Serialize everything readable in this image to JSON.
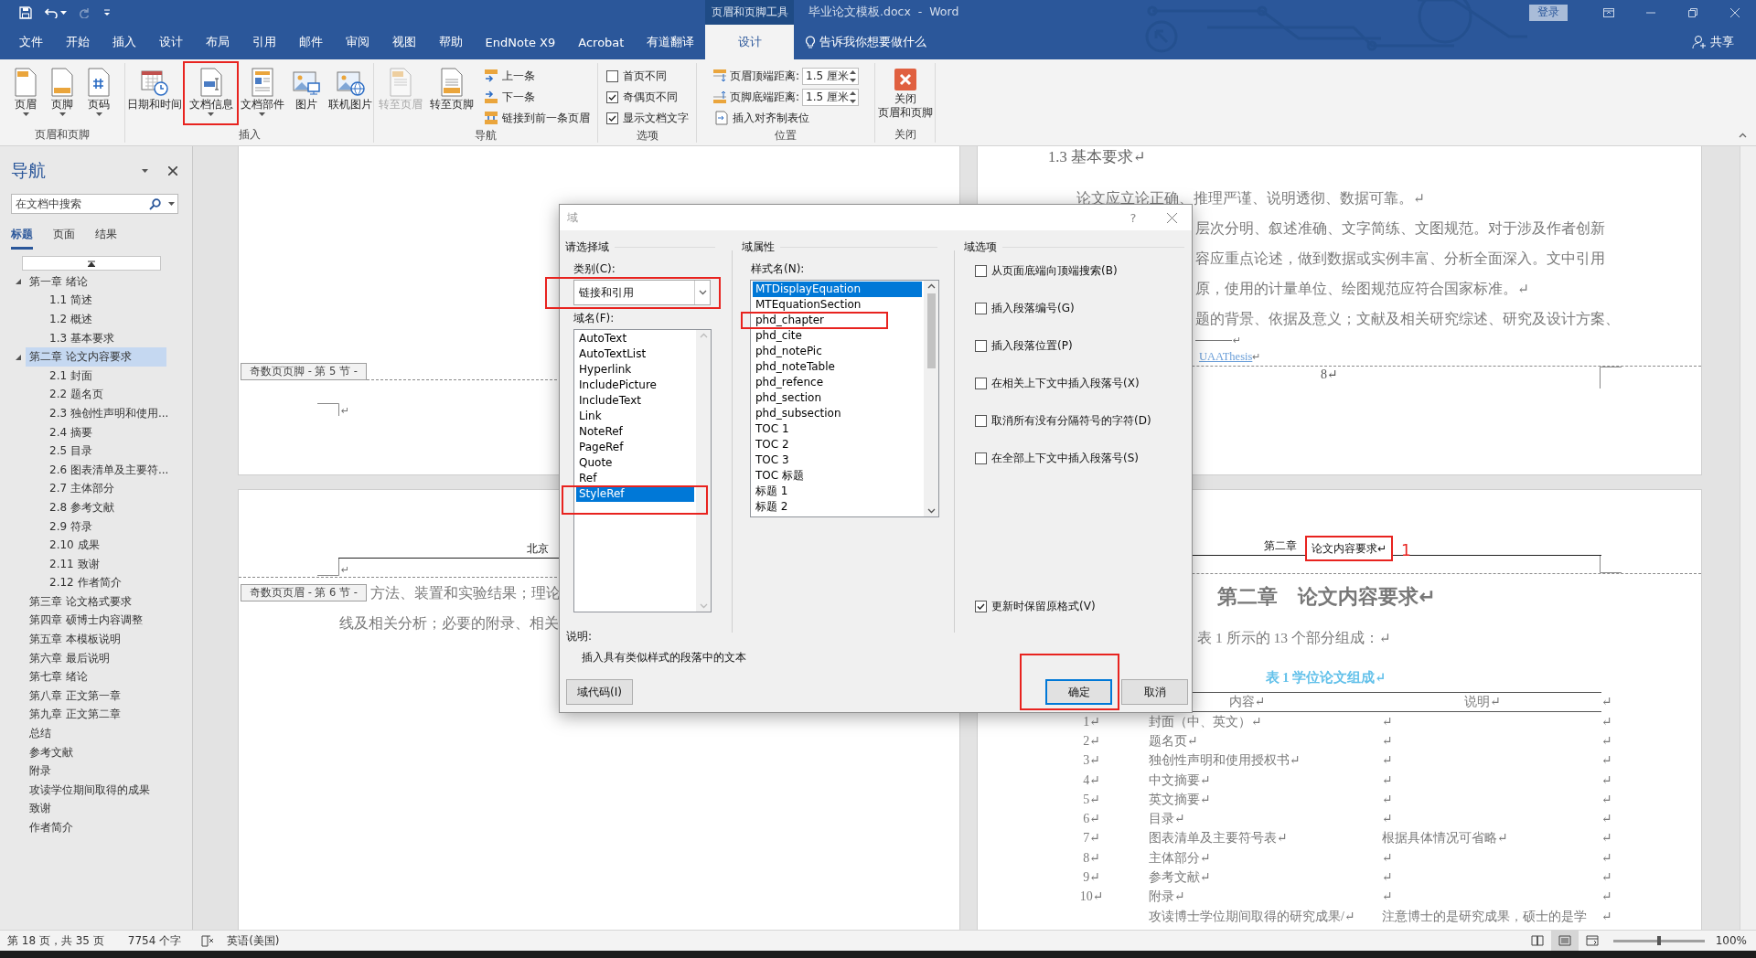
{
  "title_bar": {
    "contextual_group": "页眉和页脚工具",
    "document_title": "毕业论文模板.docx  -  Word",
    "sign_in": "登录",
    "redo_disabled": true
  },
  "menu_tabs": [
    {
      "label": "文件",
      "selected": false
    },
    {
      "label": "开始",
      "selected": false
    },
    {
      "label": "插入",
      "selected": false
    },
    {
      "label": "设计",
      "selected": false
    },
    {
      "label": "布局",
      "selected": false
    },
    {
      "label": "引用",
      "selected": false
    },
    {
      "label": "邮件",
      "selected": false
    },
    {
      "label": "审阅",
      "selected": false
    },
    {
      "label": "视图",
      "selected": false
    },
    {
      "label": "帮助",
      "selected": false
    },
    {
      "label": "EndNote X9",
      "selected": false
    },
    {
      "label": "Acrobat",
      "selected": false
    },
    {
      "label": "有道翻译",
      "selected": false
    },
    {
      "label": "设计",
      "selected": true
    }
  ],
  "tell_me": "告诉我你想要做什么",
  "share": "共享",
  "ribbon": {
    "groups": [
      {
        "label": "页眉和页脚",
        "items": [
          {
            "kind": "large",
            "label": "页眉",
            "menu": true,
            "disabled": false,
            "highlighted": false
          },
          {
            "kind": "large",
            "label": "页脚",
            "menu": true,
            "disabled": false,
            "highlighted": false
          },
          {
            "kind": "large",
            "label": "页码",
            "menu": true,
            "disabled": false,
            "highlighted": false
          }
        ]
      },
      {
        "label": "插入",
        "items": [
          {
            "kind": "large",
            "label": "日期和时间",
            "menu": false,
            "disabled": false,
            "highlighted": false
          },
          {
            "kind": "large",
            "label": "文档信息",
            "menu": true,
            "disabled": false,
            "highlighted": true
          },
          {
            "kind": "large",
            "label": "文档部件",
            "menu": true,
            "disabled": false,
            "highlighted": false
          },
          {
            "kind": "large",
            "label": "图片",
            "menu": false,
            "disabled": false,
            "highlighted": false
          },
          {
            "kind": "large",
            "label": "联机图片",
            "menu": false,
            "disabled": false,
            "highlighted": false
          }
        ]
      },
      {
        "label": "导航",
        "items": [
          {
            "kind": "large",
            "label": "转至页眉",
            "menu": false,
            "disabled": true,
            "highlighted": false
          },
          {
            "kind": "large",
            "label": "转至页脚",
            "menu": false,
            "disabled": false,
            "highlighted": false
          },
          {
            "kind": "small",
            "label": "上一条"
          },
          {
            "kind": "small",
            "label": "下一条"
          },
          {
            "kind": "small",
            "label": "链接到前一条页眉"
          }
        ]
      },
      {
        "label": "选项",
        "items": [
          {
            "kind": "check",
            "label": "首页不同",
            "checked": false
          },
          {
            "kind": "check",
            "label": "奇偶页不同",
            "checked": true
          },
          {
            "kind": "check",
            "label": "显示文档文字",
            "checked": true
          }
        ]
      },
      {
        "label": "位置",
        "items": [
          {
            "kind": "spin",
            "label": "页眉顶端距离:",
            "value": "1.5 厘米"
          },
          {
            "kind": "spin",
            "label": "页脚底端距离:",
            "value": "1.5 厘米"
          },
          {
            "kind": "small",
            "label": "插入对齐制表位"
          }
        ]
      },
      {
        "label": "关闭",
        "items": [
          {
            "kind": "large",
            "lines": [
              "关闭",
              "页眉和页脚"
            ],
            "menu": false,
            "disabled": false,
            "highlighted": false
          }
        ]
      }
    ]
  },
  "navigation": {
    "title": "导航",
    "search_placeholder": "在文档中搜索",
    "tabs": [
      {
        "label": "标题",
        "selected": true
      },
      {
        "label": "页面",
        "selected": false
      },
      {
        "label": "结果",
        "selected": false
      }
    ],
    "headings": [
      {
        "label": "第一章 绪论",
        "expanded": true,
        "selected": false,
        "children": [
          {
            "label": "1.1 简述",
            "selected": false
          },
          {
            "label": "1.2 概述",
            "selected": false
          },
          {
            "label": "1.3 基本要求",
            "selected": false
          }
        ]
      },
      {
        "label": "第二章 论文内容要求",
        "expanded": true,
        "selected": true,
        "children": [
          {
            "label": "2.1 封面",
            "selected": false
          },
          {
            "label": "2.2 题名页",
            "selected": false
          },
          {
            "label": "2.3 独创性声明和使用...",
            "selected": false
          },
          {
            "label": "2.4 摘要",
            "selected": false
          },
          {
            "label": "2.5 目录",
            "selected": false
          },
          {
            "label": "2.6 图表清单及主要符...",
            "selected": false
          },
          {
            "label": "2.7 主体部分",
            "selected": false
          },
          {
            "label": "2.8 参考文献",
            "selected": false
          },
          {
            "label": "2.9 符录",
            "selected": false
          },
          {
            "label": "2.10 成果",
            "selected": false
          },
          {
            "label": "2.11 致谢",
            "selected": false
          },
          {
            "label": "2.12 作者简介",
            "selected": false
          }
        ]
      },
      {
        "label": "第三章 论文格式要求",
        "selected": false
      },
      {
        "label": "第四章 硕博士内容调整",
        "selected": false
      },
      {
        "label": "第五章 本模板说明",
        "selected": false
      },
      {
        "label": "第六章 最后说明",
        "selected": false
      },
      {
        "label": "第七章 绪论",
        "selected": false
      },
      {
        "label": "第八章 正文第一章",
        "selected": false
      },
      {
        "label": "第九章 正文第二章",
        "selected": false
      },
      {
        "label": "总结",
        "selected": false
      },
      {
        "label": "参考文献",
        "selected": false
      },
      {
        "label": "附录",
        "selected": false
      },
      {
        "label": "攻读学位期间取得的成果",
        "selected": false
      },
      {
        "label": "致谢",
        "selected": false
      },
      {
        "label": "作者简介",
        "selected": false
      }
    ]
  },
  "document": {
    "left_top": {
      "footer_tag": "奇数页页脚 - 第 5 节 -",
      "mark": "↵"
    },
    "left_bottom": {
      "header_text": "北京",
      "mark": "↵",
      "header_tag": "奇数页页眉 - 第 6 节 -",
      "body_lines": [
        "方法、装置和实验结果；理论",
        "线及相关分析；必要的附录、相关"
      ]
    },
    "right_top": {
      "section_heading": "1.3 基本要求↵",
      "first_line": "论文应立论正确、推理严谨、说明透彻、数据可靠。↵",
      "partial_lines": [
        "层次分明、叙述准确、文字简练、文图规范。对于涉及作者创新",
        "容应重点论述，做到数据或实例丰富、分析全面深入。文中引用",
        "原，使用的计量单位、绘图规范应符合国家标准。↵",
        "题的背景、依据及意义；文献及相关研究综述、研究及设计方案、"
      ],
      "separator_mark": "↵",
      "link": "UAAThesis",
      "link_mark": "↵",
      "page_number": "8↵"
    },
    "right_bottom": {
      "header_chapter": "第二章",
      "header_title": {
        "text": "论文内容要求↵",
        "highlighted": true,
        "annotation": "1"
      },
      "chapter_heading": "第二章　论文内容要求↵",
      "intro": "表 1 所示的 13 个部分组成：↵",
      "table_caption": "表 1 学位论文组成↵",
      "table": {
        "columns": [
          "内容↵",
          "说明↵"
        ],
        "header_end": "↵",
        "rows": [
          {
            "number": "1↵",
            "content": "封面（中、英文）↵",
            "note": "↵",
            "end": "↵"
          },
          {
            "number": "2↵",
            "content": "题名页↵",
            "note": "↵",
            "end": "↵"
          },
          {
            "number": "3↵",
            "content": "独创性声明和使用授权书↵",
            "note": "↵",
            "end": "↵"
          },
          {
            "number": "4↵",
            "content": "中文摘要↵",
            "note": "↵",
            "end": "↵"
          },
          {
            "number": "5↵",
            "content": "英文摘要↵",
            "note": "↵",
            "end": "↵"
          },
          {
            "number": "6↵",
            "content": "目录↵",
            "note": "↵",
            "end": "↵"
          },
          {
            "number": "7↵",
            "content": "图表清单及主要符号表↵",
            "note": "根据具体情况可省略↵",
            "end": "↵"
          },
          {
            "number": "8↵",
            "content": "主体部分↵",
            "note": "↵",
            "end": "↵"
          },
          {
            "number": "9↵",
            "content": "参考文献↵",
            "note": "↵",
            "end": "↵"
          },
          {
            "number": "10↵",
            "content": "附录↵",
            "note": "↵",
            "end": "↵"
          },
          {
            "content": "攻读博士学位期间取得的研究成果/↵",
            "note": "注意博士的是研究成果，硕士的是学",
            "end": "↵"
          }
        ]
      }
    }
  },
  "field_dialog": {
    "title": "域",
    "help": "?",
    "select_section": "请选择域",
    "category_label": "类别(C):",
    "category": {
      "value": "链接和引用",
      "highlighted": true
    },
    "field_names_label": "域名(F):",
    "field_names": [
      {
        "label": "AutoText",
        "selected": false,
        "highlighted": false
      },
      {
        "label": "AutoTextList",
        "selected": false,
        "highlighted": false
      },
      {
        "label": "Hyperlink",
        "selected": false,
        "highlighted": false
      },
      {
        "label": "IncludePicture",
        "selected": false,
        "highlighted": false
      },
      {
        "label": "IncludeText",
        "selected": false,
        "highlighted": false
      },
      {
        "label": "Link",
        "selected": false,
        "highlighted": false
      },
      {
        "label": "NoteRef",
        "selected": false,
        "highlighted": false
      },
      {
        "label": "PageRef",
        "selected": false,
        "highlighted": false
      },
      {
        "label": "Quote",
        "selected": false,
        "highlighted": false
      },
      {
        "label": "Ref",
        "selected": false,
        "highlighted": false
      },
      {
        "label": "StyleRef",
        "selected": true,
        "highlighted": true
      }
    ],
    "properties_section": "域属性",
    "style_names_label": "样式名(N):",
    "style_names": [
      {
        "label": "MTDisplayEquation",
        "selected": true,
        "highlighted": false
      },
      {
        "label": "MTEquationSection",
        "selected": false,
        "highlighted": false
      },
      {
        "label": "phd_chapter",
        "selected": false,
        "highlighted": true
      },
      {
        "label": "phd_cite",
        "selected": false,
        "highlighted": false
      },
      {
        "label": "phd_notePic",
        "selected": false,
        "highlighted": false
      },
      {
        "label": "phd_noteTable",
        "selected": false,
        "highlighted": false
      },
      {
        "label": "phd_refence",
        "selected": false,
        "highlighted": false
      },
      {
        "label": "phd_section",
        "selected": false,
        "highlighted": false
      },
      {
        "label": "phd_subsection",
        "selected": false,
        "highlighted": false
      },
      {
        "label": "TOC 1",
        "selected": false,
        "highlighted": false
      },
      {
        "label": "TOC 2",
        "selected": false,
        "highlighted": false
      },
      {
        "label": "TOC 3",
        "selected": false,
        "highlighted": false
      },
      {
        "label": "TOC 标题",
        "selected": false,
        "highlighted": false
      },
      {
        "label": "标题 1",
        "selected": false,
        "highlighted": false
      },
      {
        "label": "标题 2",
        "selected": false,
        "highlighted": false
      }
    ],
    "options_section": "域选项",
    "options": [
      {
        "label": "从页面底端向顶端搜索(B)",
        "checked": false
      },
      {
        "label": "插入段落编号(G)",
        "checked": false
      },
      {
        "label": "插入段落位置(P)",
        "checked": false
      },
      {
        "label": "在相关上下文中插入段落号(X)",
        "checked": false
      },
      {
        "label": "取消所有没有分隔符号的字符(D)",
        "checked": false
      },
      {
        "label": "在全部上下文中插入段落号(S)",
        "checked": false
      }
    ],
    "preserve_format": {
      "label": "更新时保留原格式(V)",
      "checked": true
    },
    "description_label": "说明:",
    "description": "插入具有类似样式的段落中的文本",
    "buttons": [
      {
        "label": "域代码(I)",
        "default": false,
        "highlighted": false
      },
      {
        "label": "确定",
        "default": true,
        "highlighted": true
      },
      {
        "label": "取消",
        "default": false,
        "highlighted": false
      }
    ]
  },
  "status_bar": {
    "page": "第 18 页，共 35 页",
    "words": "7754 个字",
    "language": "英语(美国)",
    "view_modes": [
      {
        "selected": false
      },
      {
        "selected": true
      },
      {
        "selected": false
      }
    ],
    "zoom_slider": {
      "level": 0.5
    },
    "zoom": "100%"
  }
}
